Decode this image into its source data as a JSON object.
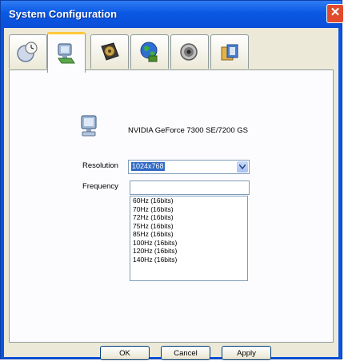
{
  "window": {
    "title": "System Configuration"
  },
  "tabs": [
    {
      "icon": "clock-globe-icon"
    },
    {
      "icon": "monitor-display-icon",
      "active": true
    },
    {
      "icon": "hard-disk-icon"
    },
    {
      "icon": "network-globe-icon"
    },
    {
      "icon": "speaker-audio-icon"
    },
    {
      "icon": "tools-package-icon"
    }
  ],
  "display": {
    "device_name": "NVIDIA GeForce 7300 SE/7200 GS",
    "resolution_label": "Resolution",
    "resolution_value": "1024x768",
    "frequency_label": "Frequency",
    "frequency_value": "",
    "frequency_options": [
      "60Hz (16bits)",
      "70Hz (16bits)",
      "72Hz (16bits)",
      "75Hz (16bits)",
      "85Hz (16bits)",
      "100Hz (16bits)",
      "120Hz (16bits)",
      "140Hz (16bits)"
    ]
  },
  "buttons": {
    "ok": "OK",
    "cancel": "Cancel",
    "apply": "Apply"
  },
  "colors": {
    "titlebar": "#0a58e3",
    "selection": "#316ac5",
    "tab_accent": "#ffc83c"
  }
}
